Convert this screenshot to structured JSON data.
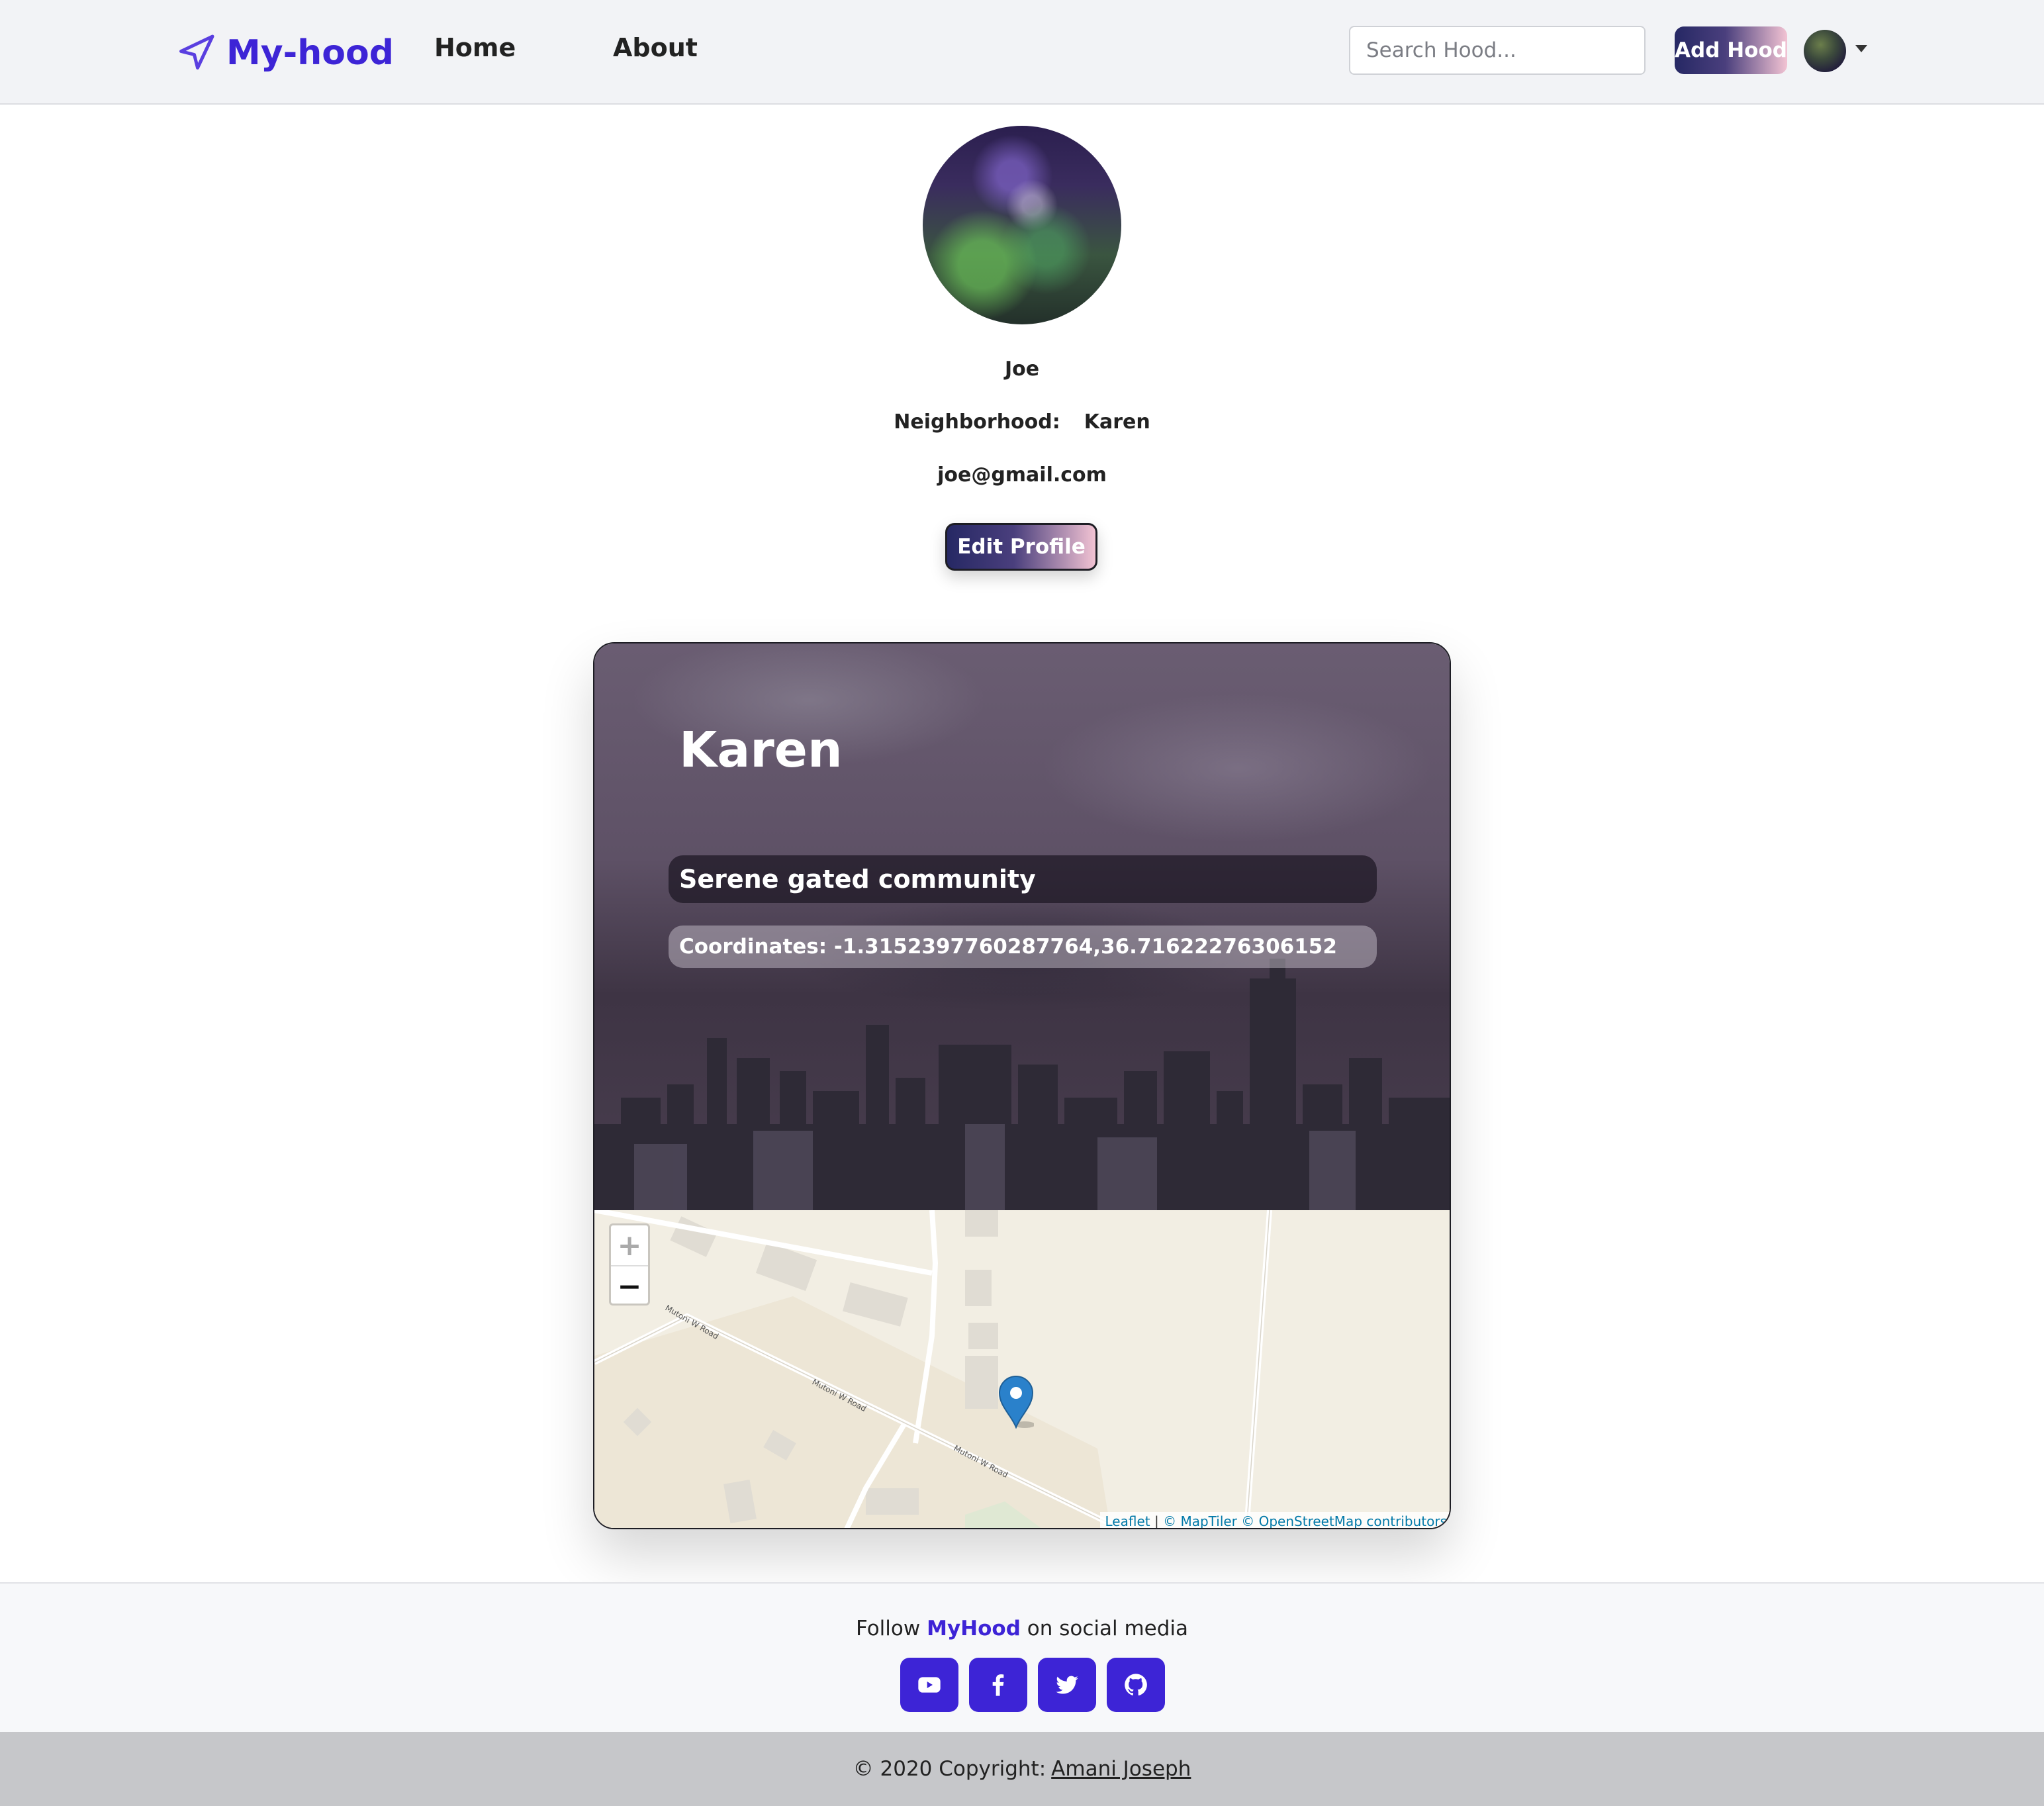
{
  "navbar": {
    "brand": "My-hood",
    "links": [
      "Home",
      "About"
    ],
    "search_placeholder": "Search Hood...",
    "add_button": "Add Hood"
  },
  "profile": {
    "username": "Joe",
    "neighborhood_label": "Neighborhood:",
    "neighborhood_value": "Karen",
    "email": "joe@gmail.com",
    "edit_button": "Edit Profile"
  },
  "hood_card": {
    "name": "Karen",
    "description": "Serene gated community",
    "coordinates": "Coordinates: -1.3152397760287764,36.71622276306152"
  },
  "map": {
    "zoom_in": "+",
    "zoom_out": "−",
    "road_labels": [
      "Mutoni W Road",
      "Mutoni W Road",
      "Mutoni W Road"
    ],
    "attribution_leaflet": "Leaflet",
    "attribution_separator": "|",
    "attribution_rest": "© MapTiler © OpenStreetMap contributors"
  },
  "footer": {
    "follow_prefix": "Follow",
    "follow_brand": "MyHood",
    "follow_suffix": "on social media",
    "socials": [
      "youtube-icon",
      "facebook-icon",
      "twitter-icon",
      "github-icon"
    ],
    "copyright_prefix": "© 2020 Copyright:",
    "copyright_name": "Amani Joseph"
  },
  "colors": {
    "brand": "#3d24d6",
    "navbar_bg": "#f2f3f6",
    "button_gradient_start": "#262864",
    "button_gradient_end": "#f2c3d3",
    "copyright_bar": "#c6c7ca"
  }
}
